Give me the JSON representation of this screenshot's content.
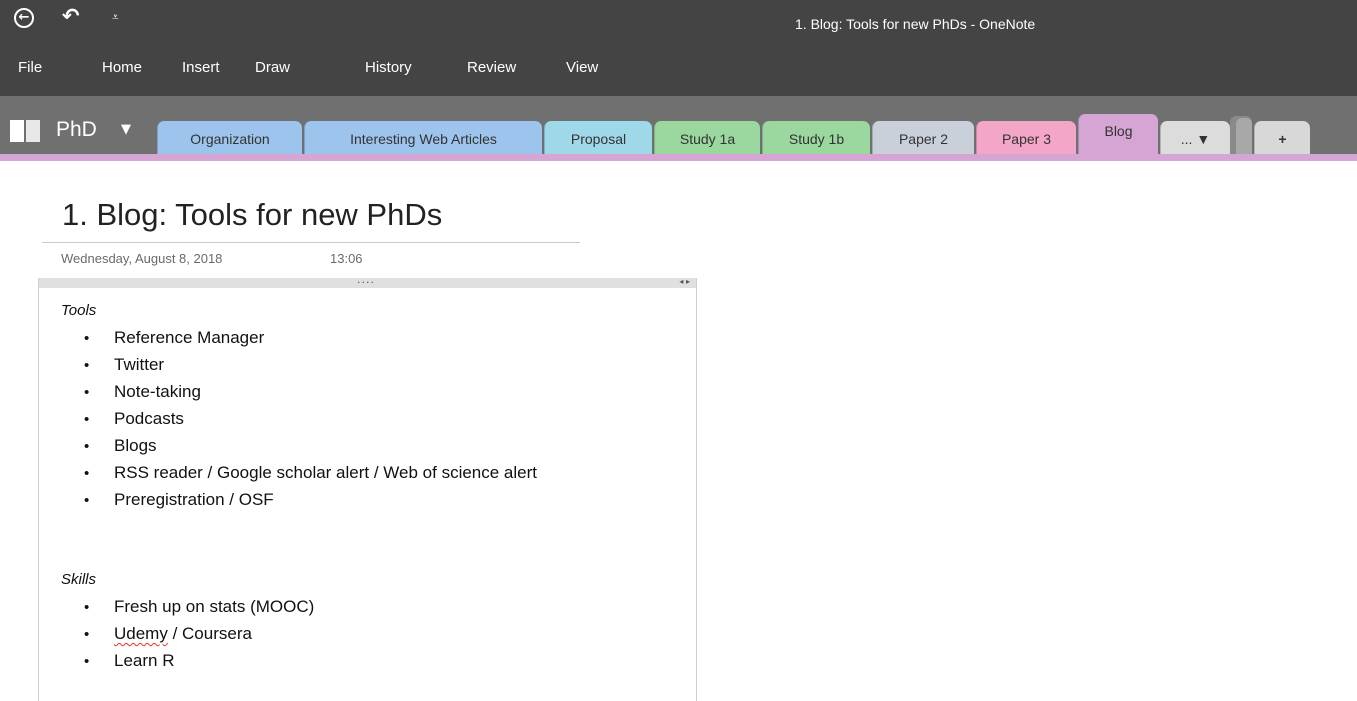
{
  "titlebar": {
    "back_glyph": "←",
    "undo_glyph": "↶",
    "customize_glyph": "⩡",
    "title": "1. Blog: Tools for new PhDs - OneNote"
  },
  "menu": {
    "items": [
      "File",
      "Home",
      "Insert",
      "Draw",
      "History",
      "Review",
      "View"
    ]
  },
  "notebook": {
    "name": "PhD",
    "caret": "▼"
  },
  "sections": [
    {
      "label": "Organization",
      "color": "#9dc4ec"
    },
    {
      "label": "Interesting Web Articles",
      "color": "#9dc4ec"
    },
    {
      "label": "Proposal",
      "color": "#9fd8e8"
    },
    {
      "label": "Study 1a",
      "color": "#9ad8a0"
    },
    {
      "label": "Study 1b",
      "color": "#9ad8a0"
    },
    {
      "label": "Paper 2",
      "color": "#c9d0da"
    },
    {
      "label": "Paper 3",
      "color": "#f4a6c8"
    },
    {
      "label": "Blog",
      "color": "#d5a5d3",
      "active": true
    },
    {
      "label": "... ▼",
      "color": "#dcdcdc"
    },
    {
      "label": "+",
      "color": "#d8d8d8"
    }
  ],
  "page": {
    "title": "1. Blog: Tools for new PhDs",
    "date": "Wednesday, August 8, 2018",
    "time": "13:06",
    "drag_handle": "....",
    "resize_arrows": "◂ ▸",
    "bullet": "•",
    "tools_heading": "Tools",
    "tools": [
      "Reference Manager",
      "Twitter",
      "Note-taking",
      "Podcasts",
      "Blogs",
      "RSS reader / Google scholar alert / Web of science alert",
      "Preregistration / OSF"
    ],
    "skills_heading": "Skills",
    "skills": [
      "Fresh up on stats (MOOC)",
      "Udemy",
      " / Coursera",
      "Learn R"
    ]
  }
}
